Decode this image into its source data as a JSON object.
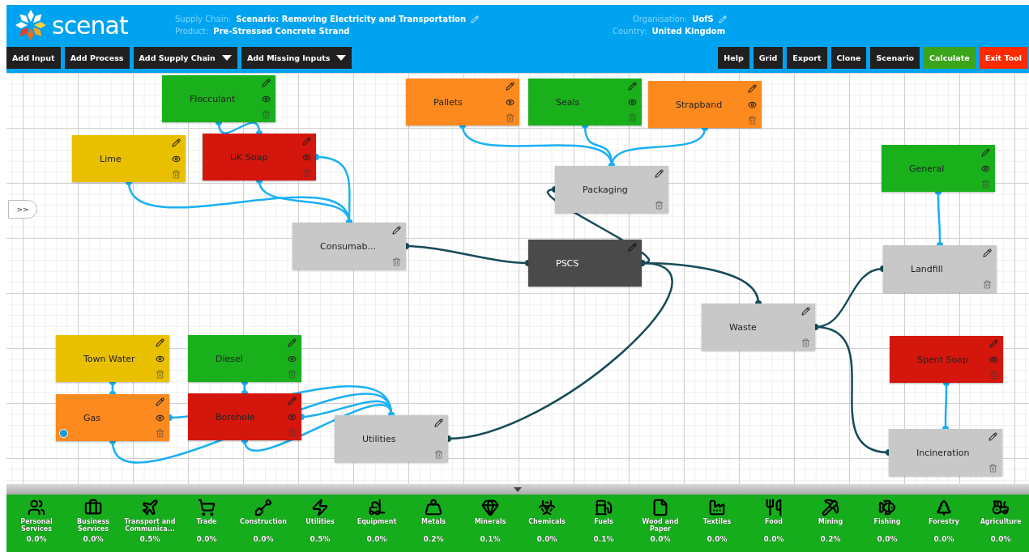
{
  "header": {
    "logo": "scenat",
    "info": [
      {
        "label": "Supply Chain:",
        "value": "Scenario: Removing Electricity and Transportation",
        "editable": true
      },
      {
        "label": "Product:",
        "value": "Pre-Stressed Concrete Strand",
        "editable": false
      }
    ],
    "org_info": [
      {
        "label": "Organisation:",
        "value": "UofS",
        "editable": true
      },
      {
        "label": "Country:",
        "value": "United Kingdom",
        "editable": false
      }
    ]
  },
  "toolbar_left": [
    {
      "label": "Add Input",
      "dropdown": false
    },
    {
      "label": "Add Process",
      "dropdown": false
    },
    {
      "label": "Add Supply Chain",
      "dropdown": true
    },
    {
      "label": "Add Missing Inputs",
      "dropdown": true
    }
  ],
  "toolbar_right": [
    {
      "label": "Help",
      "kind": "default"
    },
    {
      "label": "Grid",
      "kind": "default"
    },
    {
      "label": "Export",
      "kind": "default"
    },
    {
      "label": "Clone",
      "kind": "default"
    },
    {
      "label": "Scenario",
      "kind": "default"
    },
    {
      "label": "Calculate",
      "kind": "success"
    },
    {
      "label": "Exit Tool",
      "kind": "danger"
    }
  ],
  "panel_toggle": ">>",
  "nodes": [
    {
      "label": "Flocculant",
      "kind": "input",
      "color": "#19b01c",
      "info": false
    },
    {
      "label": "Lime",
      "kind": "input",
      "color": "#e8c000",
      "info": false
    },
    {
      "label": "UK Soap",
      "kind": "input",
      "color": "#d5160c",
      "info": false
    },
    {
      "label": "Consumab...",
      "kind": "process",
      "color": "#c8c8c8",
      "info": false
    },
    {
      "label": "Pallets",
      "kind": "input",
      "color": "#fd8a1e",
      "info": false
    },
    {
      "label": "Seals",
      "kind": "input",
      "color": "#19b01c",
      "info": false
    },
    {
      "label": "Strapband",
      "kind": "input",
      "color": "#fd8a1e",
      "info": false
    },
    {
      "label": "Packaging",
      "kind": "process",
      "color": "#c8c8c8",
      "info": false
    },
    {
      "label": "PSCS",
      "kind": "product",
      "color": "#4a4a4a",
      "info": false
    },
    {
      "label": "General",
      "kind": "input",
      "color": "#19b01c",
      "info": false
    },
    {
      "label": "Landfill",
      "kind": "process",
      "color": "#c8c8c8",
      "info": false
    },
    {
      "label": "Waste",
      "kind": "process",
      "color": "#c8c8c8",
      "info": false
    },
    {
      "label": "Spent Soap",
      "kind": "input",
      "color": "#d5160c",
      "info": false
    },
    {
      "label": "Incineration",
      "kind": "process",
      "color": "#c8c8c8",
      "info": false
    },
    {
      "label": "Town Water",
      "kind": "input",
      "color": "#e8c000",
      "info": false
    },
    {
      "label": "Diesel",
      "kind": "input",
      "color": "#19b01c",
      "info": false
    },
    {
      "label": "Gas",
      "kind": "input",
      "color": "#fd8a1e",
      "info": true
    },
    {
      "label": "Borehole",
      "kind": "input",
      "color": "#d5160c",
      "info": false
    },
    {
      "label": "Utilities",
      "kind": "process",
      "color": "#c8c8c8",
      "info": false
    }
  ],
  "sectors": [
    {
      "name": "Personal Services",
      "share": "0.0%"
    },
    {
      "name": "Business Services",
      "share": "0.0%"
    },
    {
      "name": "Transport and Communica...",
      "share": "0.5%"
    },
    {
      "name": "Trade",
      "share": "0.0%"
    },
    {
      "name": "Construction",
      "share": "0.0%"
    },
    {
      "name": "Utilities",
      "share": "0.5%"
    },
    {
      "name": "Equipment",
      "share": "0.0%"
    },
    {
      "name": "Metals",
      "share": "0.2%"
    },
    {
      "name": "Minerals",
      "share": "0.1%"
    },
    {
      "name": "Chemicals",
      "share": "0.0%"
    },
    {
      "name": "Fuels",
      "share": "0.1%"
    },
    {
      "name": "Wood and Paper",
      "share": "0.0%"
    },
    {
      "name": "Textiles",
      "share": "0.0%"
    },
    {
      "name": "Food",
      "share": "0.0%"
    },
    {
      "name": "Mining",
      "share": "0.2%"
    },
    {
      "name": "Fishing",
      "share": "0.0%"
    },
    {
      "name": "Forestry",
      "share": "0.0%"
    },
    {
      "name": "Agriculture",
      "share": "0.0%"
    }
  ]
}
